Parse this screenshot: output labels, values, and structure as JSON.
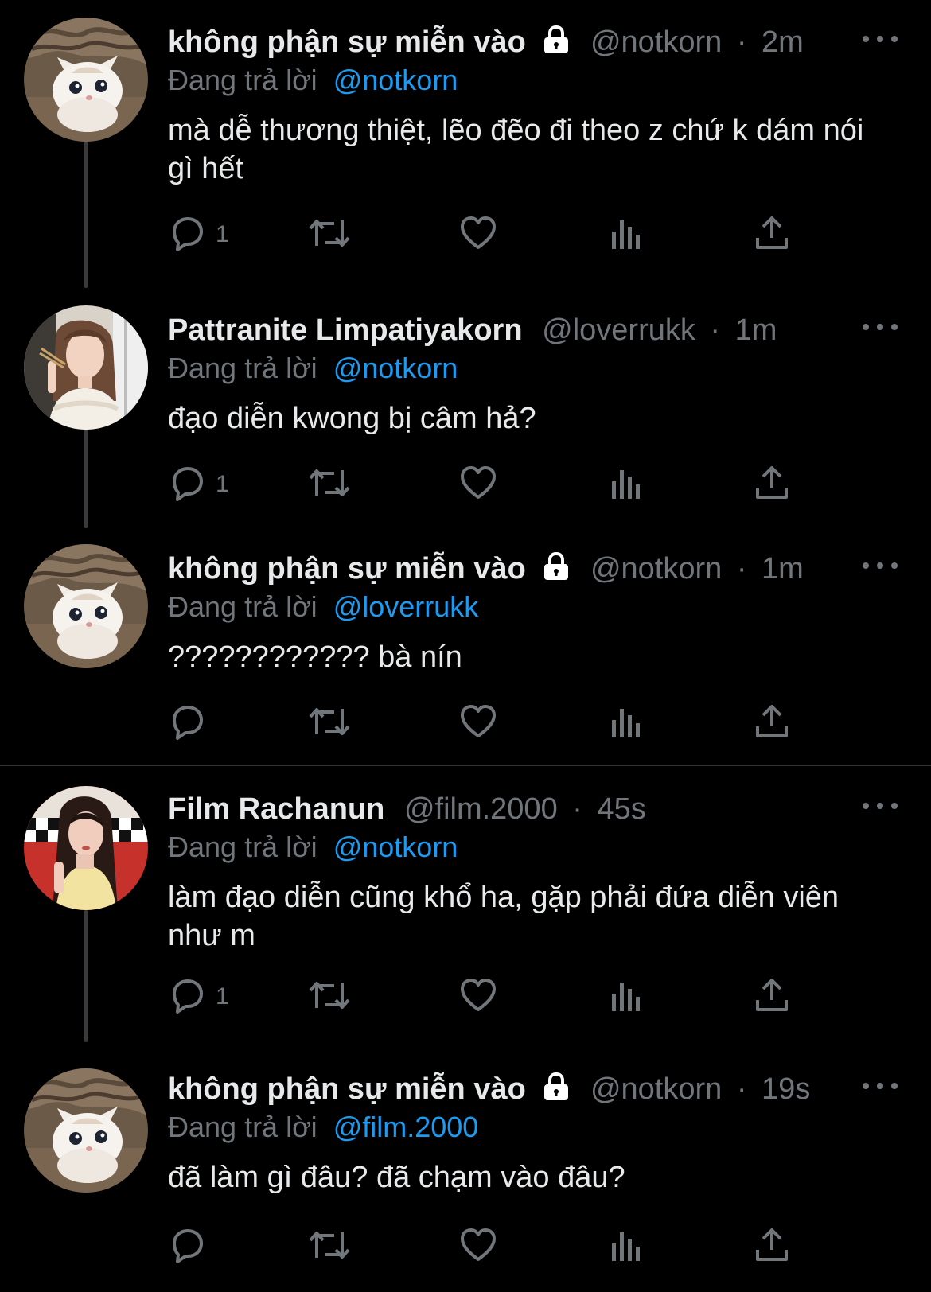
{
  "colors": {
    "background": "#000000",
    "text": "#e7e9ea",
    "muted": "#71767b",
    "mention": "#1d9bf0",
    "thread_line": "#3a3a3c"
  },
  "tweets": [
    {
      "display_name": "không phận sự miễn vào",
      "locked": true,
      "handle": "@notkorn",
      "separator": "·",
      "time": "2m",
      "reply_prefix": "Đang trả lời",
      "reply_to": "@notkorn",
      "text": "mà dễ thương thiệt, lẽo đẽo đi theo z chứ k dám nói gì hết",
      "reply_count": "1",
      "avatar": "kitten-avatar"
    },
    {
      "display_name": "Pattranite Limpatiyakorn",
      "locked": false,
      "handle": "@loverrukk",
      "separator": "·",
      "time": "1m",
      "reply_prefix": "Đang trả lời",
      "reply_to": "@notkorn",
      "text": "đạo diễn kwong bị câm hả?",
      "reply_count": "1",
      "avatar": "woman-avatar"
    },
    {
      "display_name": "không phận sự miễn vào",
      "locked": true,
      "handle": "@notkorn",
      "separator": "·",
      "time": "1m",
      "reply_prefix": "Đang trả lời",
      "reply_to": "@loverrukk",
      "text": "???????????? bà nín",
      "reply_count": "",
      "avatar": "kitten-avatar"
    },
    {
      "display_name": "Film Rachanun",
      "locked": false,
      "handle": "@film.2000",
      "separator": "·",
      "time": "45s",
      "reply_prefix": "Đang trả lời",
      "reply_to": "@notkorn",
      "text": "làm đạo diễn cũng khổ ha, gặp phải đứa diễn viên như m",
      "reply_count": "1",
      "avatar": "woman-red-avatar"
    },
    {
      "display_name": "không phận sự miễn vào",
      "locked": true,
      "handle": "@notkorn",
      "separator": "·",
      "time": "19s",
      "reply_prefix": "Đang trả lời",
      "reply_to": "@film.2000",
      "text": "đã làm gì đâu? đã chạm vào đâu?",
      "reply_count": "",
      "avatar": "kitten-avatar"
    }
  ],
  "icons": {
    "reply": "reply-icon",
    "retweet": "retweet-icon",
    "like": "heart-icon",
    "views": "views-icon",
    "share": "share-icon",
    "more": "more-icon",
    "lock": "lock-icon"
  }
}
